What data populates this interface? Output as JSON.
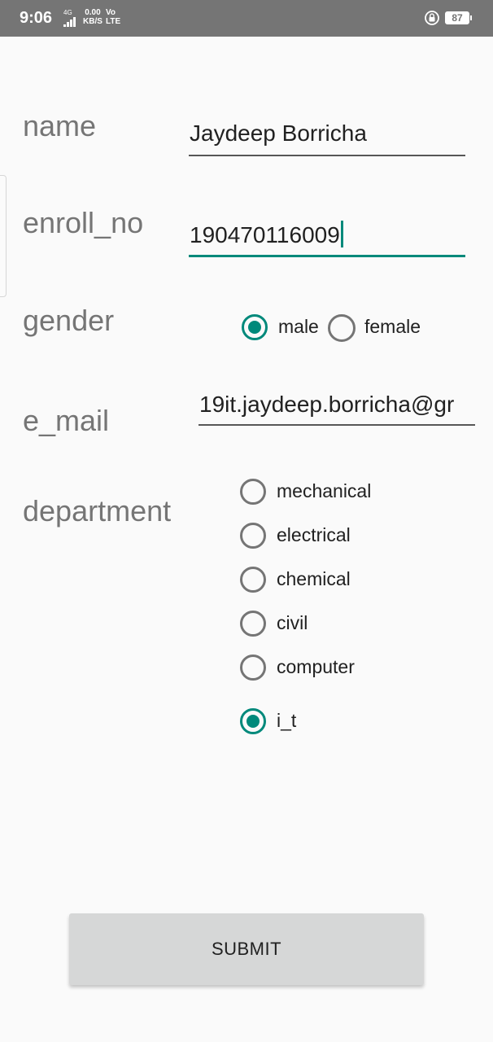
{
  "status_bar": {
    "time": "9:06",
    "network_type": "4G",
    "speed_value": "0.00",
    "speed_unit": "KB/S",
    "volte_top": "Vo",
    "volte_bottom": "LTE",
    "battery": "87"
  },
  "form": {
    "name": {
      "label": "name",
      "value": "Jaydeep Borricha"
    },
    "enroll_no": {
      "label": "enroll_no",
      "value": "190470116009"
    },
    "gender": {
      "label": "gender",
      "options": [
        {
          "label": "male",
          "checked": true
        },
        {
          "label": "female",
          "checked": false
        }
      ]
    },
    "e_mail": {
      "label": "e_mail",
      "value": "19it.jaydeep.borricha@gr"
    },
    "department": {
      "label": "department",
      "options": [
        {
          "label": "mechanical",
          "checked": false
        },
        {
          "label": "electrical",
          "checked": false
        },
        {
          "label": "chemical",
          "checked": false
        },
        {
          "label": "civil",
          "checked": false
        },
        {
          "label": "computer",
          "checked": false
        },
        {
          "label": "i_t",
          "checked": true
        }
      ]
    }
  },
  "submit_label": "SUBMIT",
  "colors": {
    "accent": "#00897b",
    "status_bar": "#757575",
    "button": "#d6d7d7"
  }
}
